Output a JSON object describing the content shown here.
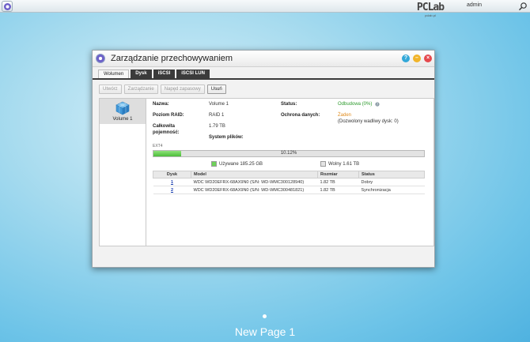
{
  "topbar": {
    "user": "admin",
    "logo_mark": "PCLab",
    "logo_sub": "pclab.pl"
  },
  "window": {
    "title": "Zarządzanie przechowywaniem",
    "tabs": [
      {
        "label": "Wolumen",
        "active": true
      },
      {
        "label": "Dysk",
        "active": false
      },
      {
        "label": "iSCSI",
        "active": false
      },
      {
        "label": "iSCSI LUN",
        "active": false
      }
    ],
    "toolbar": {
      "create": "Utwórz",
      "manage": "Zarządzanie",
      "hot_spare": "Napęd zapasowy",
      "remove": "Usuń"
    }
  },
  "volumes": [
    {
      "label": "Volume 1",
      "selected": true
    }
  ],
  "details": {
    "name_label": "Nazwa:",
    "name_value": "Volume 1",
    "status_label": "Status:",
    "status_value": "Odbudowa (0%)",
    "raid_label": "Poziom RAID:",
    "raid_value": "RAID 1",
    "protection_label": "Ochrona danych:",
    "protection_value": "Żaden",
    "protection_note": "(Dozwolony wadliwy dysk: 0)",
    "capacity_label": "Całkowita pojemność:",
    "capacity_value": "1.79 TB",
    "fs_label": "System plików:",
    "fs_value": "EXT4",
    "usage_percent": 10.12,
    "usage_label": "10.12%",
    "used_label": "Używane 185.25 GB",
    "free_label": "Wolny 1.61 TB"
  },
  "disk_table": {
    "headers": [
      "Dysk",
      "Model",
      "Rozmiar",
      "Status"
    ],
    "rows": [
      {
        "disk": "1",
        "model": "WDC WD20EFRX-68AX9N0 (S/N: WD-WMC300128940)",
        "size": "1.82 TB",
        "status": "Dobry"
      },
      {
        "disk": "2",
        "model": "WDC WD20EFRX-68AX9N0 (S/N: WD-WMC300481821)",
        "size": "1.82 TB",
        "status": "Synchronizacja"
      }
    ]
  },
  "desktop": {
    "page_label": "New Page 1"
  },
  "colors": {
    "used": "#4cbd3a",
    "free": "#e3e3e3",
    "status_rebuild": "#2c9a2c",
    "protection_none": "#e08a1a",
    "tab_dark": "#3b3b3b"
  }
}
